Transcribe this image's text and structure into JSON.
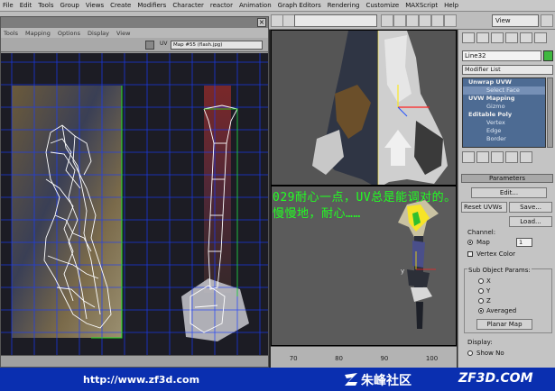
{
  "menu": [
    "File",
    "Edit",
    "Tools",
    "Group",
    "Views",
    "Create",
    "Modifiers",
    "Character",
    "reactor",
    "Animation",
    "Graph Editors",
    "Rendering",
    "Customize",
    "MAXScript",
    "Help"
  ],
  "toolbar": {
    "view_combo": "View"
  },
  "uv_editor": {
    "menu": [
      "Tools",
      "Mapping",
      "Options",
      "Display",
      "View"
    ],
    "texture_combo": "Map #55 (flash.jpg)",
    "uv_label": "UV"
  },
  "viewport_timeline": {
    "ticks": [
      "70",
      "80",
      "90",
      "100"
    ]
  },
  "command_panel": {
    "object_name": "Line32",
    "object_color": "#3fb83f",
    "modifier_list": "Modifier List",
    "stack": [
      {
        "label": "Unwrap UVW",
        "type": "main"
      },
      {
        "label": "Select Face",
        "type": "sub-selected"
      },
      {
        "label": "UVW Mapping",
        "type": "main"
      },
      {
        "label": "Gizmo",
        "type": "sub"
      },
      {
        "label": "Editable Poly",
        "type": "main"
      },
      {
        "label": "Vertex",
        "type": "sub"
      },
      {
        "label": "Edge",
        "type": "sub"
      },
      {
        "label": "Border",
        "type": "sub"
      }
    ]
  },
  "parameters": {
    "title": "Parameters",
    "edit_label": "Edit...",
    "reset_label": "Reset UVWs",
    "save_label": "Save...",
    "load_label": "Load...",
    "channel_label": "Channel:",
    "map_label": "Map",
    "map_channel": "1",
    "vertex_color_label": "Vertex Color",
    "subobj_label": "Sub Object Params:",
    "x_label": "X",
    "y_label": "Y",
    "z_label": "Z",
    "averaged_label": "Averaged",
    "planar_map_label": "Planar Map",
    "display_label": "Display:",
    "show_no_label": "Show No"
  },
  "overlay_note": {
    "line1": "029耐心一点，UV总是能调对的。",
    "line2": "慢慢地，耐心……"
  },
  "banner": {
    "url": "http://www.zf3d.com",
    "brand": "朱峰社区",
    "site": "ZF3D.COM"
  }
}
